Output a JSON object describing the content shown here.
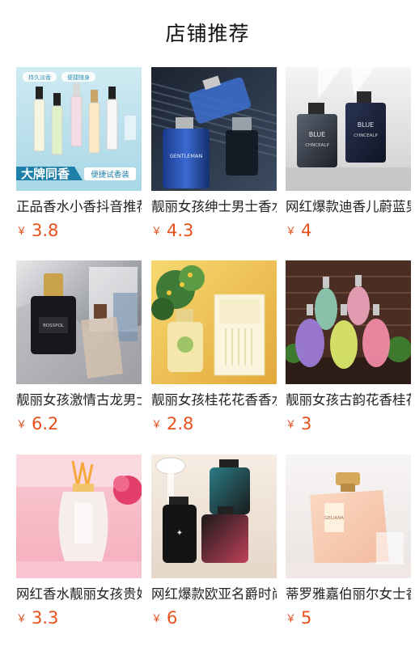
{
  "page": {
    "title": "店铺推荐"
  },
  "products": [
    {
      "name": "正品香水小香抖音推荐",
      "currency": "￥",
      "price": "3.8",
      "image_icon": "perfume-vials-image",
      "badges": [
        "持久淡香",
        "便捷随身"
      ],
      "banner_main": "大牌同香",
      "banner_sub": "便捷试香装"
    },
    {
      "name": "靓丽女孩绅士男士香水",
      "currency": "￥",
      "price": "4.3",
      "image_icon": "blue-cologne-image",
      "bottle_text": "GENTLEMAN"
    },
    {
      "name": "网红爆款迪香儿蔚蓝男士",
      "currency": "￥",
      "price": "4",
      "image_icon": "bleu-bottles-image",
      "bottle_text_1": "BLUE",
      "bottle_text_2": "CHNCEALP"
    },
    {
      "name": "靓丽女孩激情古龙男士",
      "currency": "￥",
      "price": "6.2",
      "image_icon": "black-bottle-image",
      "bottle_text": "BOSSPOL"
    },
    {
      "name": "靓丽女孩桂花花香香水",
      "currency": "￥",
      "price": "2.8",
      "image_icon": "osmanthus-perfume-image"
    },
    {
      "name": "靓丽女孩古韵花香桂花",
      "currency": "￥",
      "price": "3",
      "image_icon": "colorful-bottles-image"
    },
    {
      "name": "网红香水靓丽女孩贵妇",
      "currency": "￥",
      "price": "3.3",
      "image_icon": "pink-flower-bottle-image"
    },
    {
      "name": "网红爆款欧亚名爵时尚",
      "currency": "￥",
      "price": "6",
      "image_icon": "dark-bottles-image"
    },
    {
      "name": "蒂罗雅嘉伯丽尔女士香水",
      "currency": "￥",
      "price": "5",
      "image_icon": "peach-bottle-image",
      "bottle_text": "GELIANA"
    }
  ]
}
